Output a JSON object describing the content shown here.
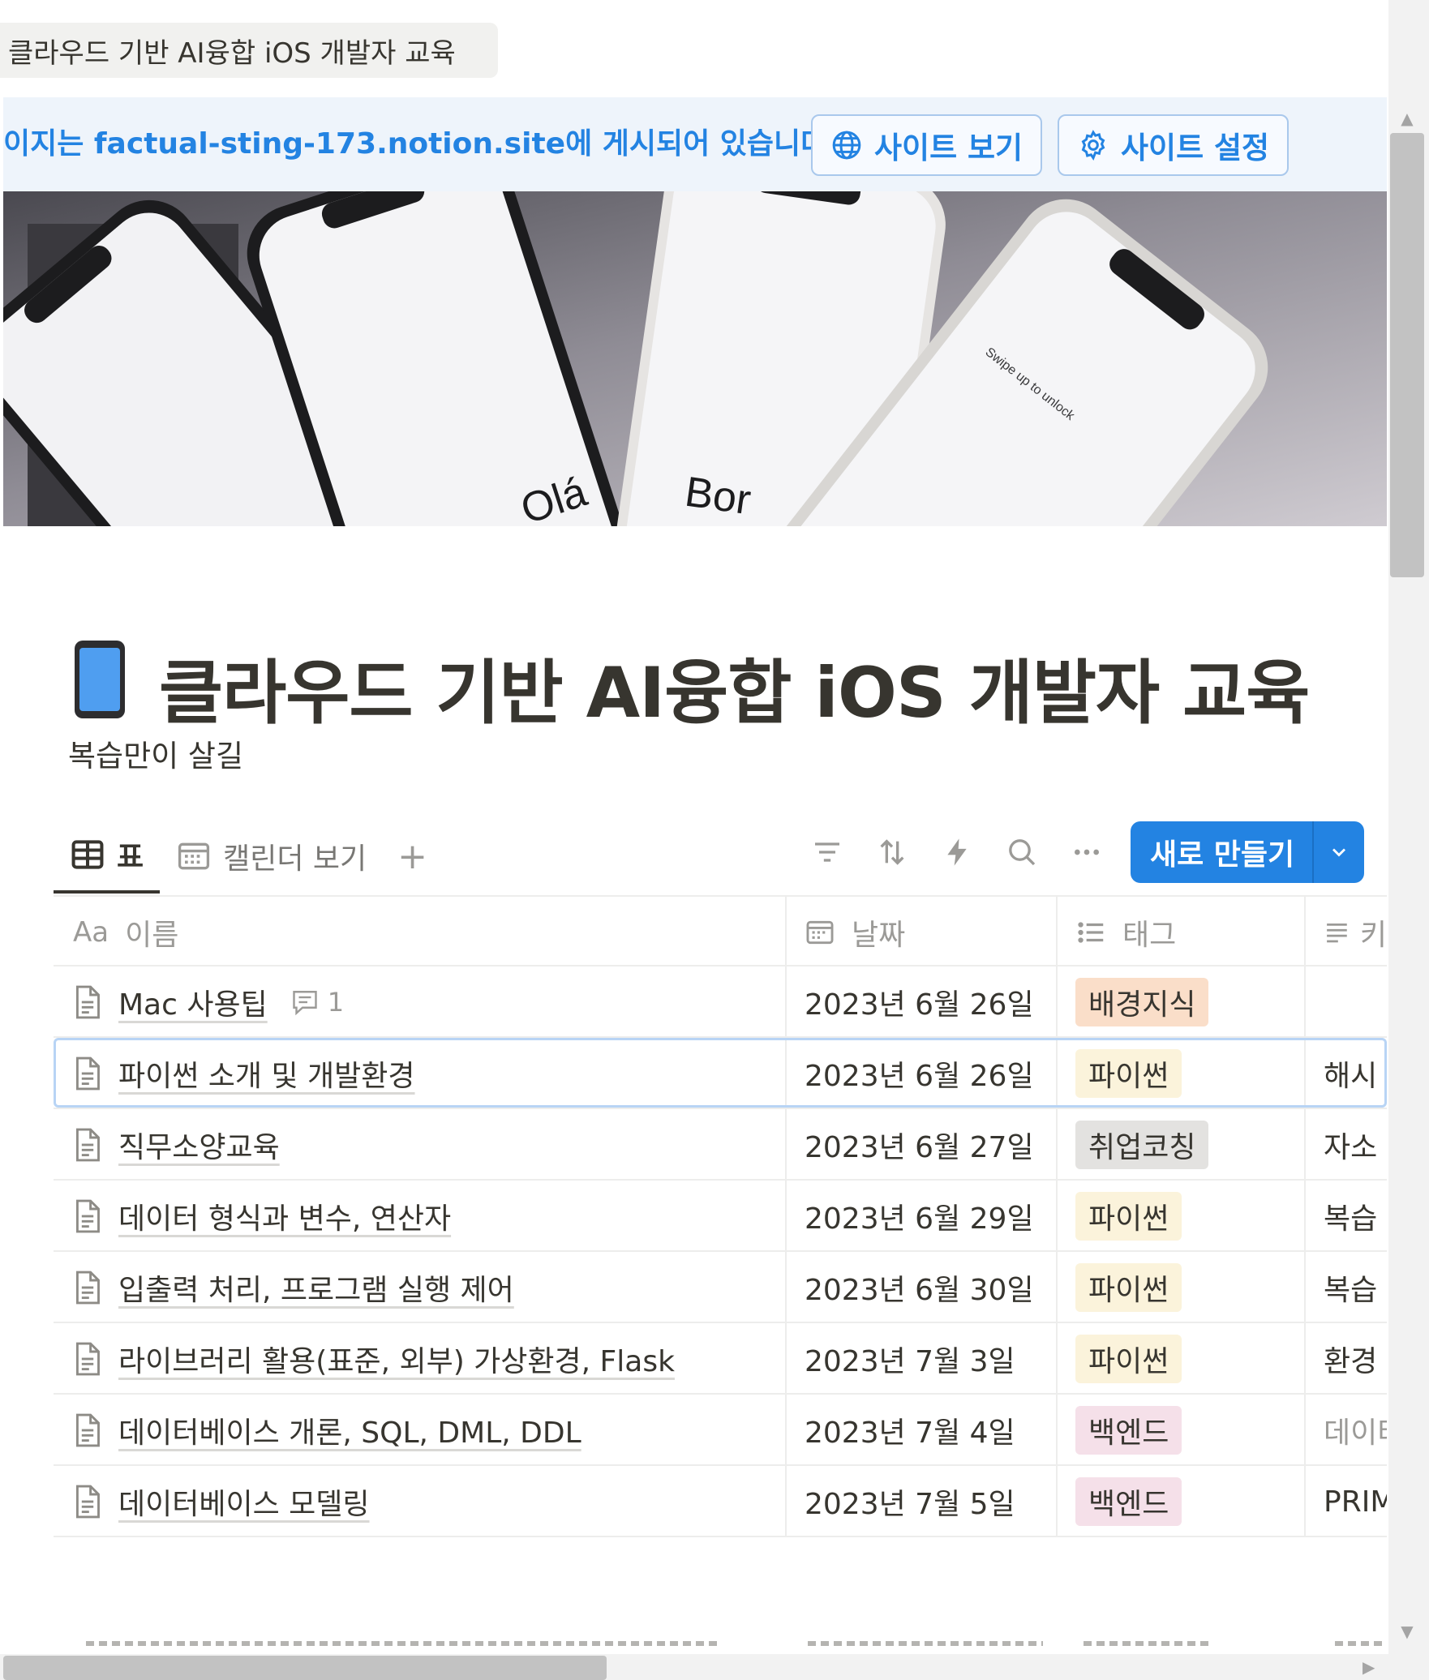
{
  "browser_tab": {
    "title": "클라우드 기반 AI융합 iOS 개발자 교육"
  },
  "publish_banner": {
    "message": "이지는 factual-sting-173.notion.site에 게시되어 있습니다.",
    "view_site_label": "사이트 보기",
    "site_settings_label": "사이트 설정",
    "color": "#2383e2"
  },
  "cover": {
    "description_icon": "iphone-cover-image",
    "texts": [
      "Olá",
      "Bor",
      "Swipe up to unlock"
    ]
  },
  "page": {
    "icon": "mobile-phone-icon",
    "title": "클라우드 기반 AI융합 iOS 개발자 교육",
    "description": "복습만이 살길"
  },
  "views": {
    "tabs": [
      {
        "label": "표",
        "icon": "table-icon",
        "active": true
      },
      {
        "label": "캘린더 보기",
        "icon": "calendar-icon",
        "active": false
      }
    ],
    "add_label": "+"
  },
  "toolbar": {
    "icons": [
      "filter-icon",
      "sort-icon",
      "automation-icon",
      "search-icon",
      "more-icon"
    ],
    "new_label": "새로 만들기",
    "accent": "#2383e2"
  },
  "table": {
    "columns": [
      {
        "prefix": "Aa",
        "label": "이름",
        "icon": "text-property-icon"
      },
      {
        "label": "날짜",
        "icon": "date-property-icon"
      },
      {
        "label": "태그",
        "icon": "multiselect-property-icon"
      },
      {
        "label": "키",
        "icon": "text-lines-icon"
      }
    ],
    "rows": [
      {
        "name": "Mac 사용팁",
        "comments": "1",
        "date": "2023년 6월 26일",
        "tag": "배경지식",
        "tag_color": "#fadec9",
        "extra": ""
      },
      {
        "name": "파이썬 소개 및 개발환경",
        "date": "2023년 6월 26일",
        "tag": "파이썬",
        "tag_color": "#fbf3db",
        "extra": "해시",
        "selected": true
      },
      {
        "name": "직무소양교육",
        "date": "2023년 6월 27일",
        "tag": "취업코칭",
        "tag_color": "#e3e2e0",
        "extra": "자소"
      },
      {
        "name": "데이터 형식과 변수, 연산자",
        "date": "2023년 6월 29일",
        "tag": "파이썬",
        "tag_color": "#fbf3db",
        "extra": "복습"
      },
      {
        "name": "입출력 처리, 프로그램 실행 제어",
        "date": "2023년 6월 30일",
        "tag": "파이썬",
        "tag_color": "#fbf3db",
        "extra": "복습"
      },
      {
        "name": "라이브러리 활용(표준, 외부) 가상환경, Flask",
        "date": "2023년 7월 3일",
        "tag": "파이썬",
        "tag_color": "#fbf3db",
        "extra": "환경"
      },
      {
        "name": "데이터베이스 개론, SQL, DML, DDL",
        "date": "2023년 7월 4일",
        "tag": "백엔드",
        "tag_color": "#f5e0e9",
        "extra": "데이터",
        "extra_muted": true
      },
      {
        "name": "데이터베이스 모델링",
        "date": "2023년 7월 5일",
        "tag": "백엔드",
        "tag_color": "#f5e0e9",
        "extra": "PRIM"
      }
    ]
  }
}
